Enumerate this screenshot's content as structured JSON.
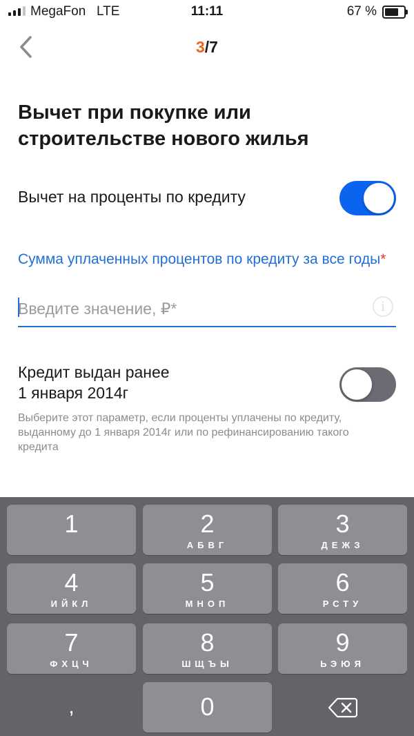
{
  "status_bar": {
    "carrier": "MegaFon",
    "network": "LTE",
    "time": "11:11",
    "battery": "67 %"
  },
  "header": {
    "step_current": "3",
    "step_total": "/7"
  },
  "title": "Вычет при покупке или строительстве нового жилья",
  "interest_toggle": {
    "label": "Вычет на проценты по кредиту",
    "on": true
  },
  "interest_field": {
    "label": "Сумма уплаченных процентов по кредиту за все годы",
    "required_mark": "*",
    "value": "",
    "placeholder": "Введите значение, ₽*",
    "info": "i"
  },
  "old_credit_toggle": {
    "label_line1": "Кредит выдан ранее",
    "label_line2": "1 января 2014г",
    "on": false,
    "hint": "Выберите этот параметр, если проценты уплачены по кредиту, выданному до 1 января 2014г или по рефинансированию такого кредита"
  },
  "keyboard": {
    "keys": [
      {
        "num": "1",
        "letters": ""
      },
      {
        "num": "2",
        "letters": "АБВГ"
      },
      {
        "num": "3",
        "letters": "ДЕЖЗ"
      },
      {
        "num": "4",
        "letters": "ИЙКЛ"
      },
      {
        "num": "5",
        "letters": "МНОП"
      },
      {
        "num": "6",
        "letters": "РСТУ"
      },
      {
        "num": "7",
        "letters": "ФХЦЧ"
      },
      {
        "num": "8",
        "letters": "ШЩЪЫ"
      },
      {
        "num": "9",
        "letters": "ЬЭЮЯ"
      }
    ],
    "comma": ",",
    "zero": "0"
  },
  "colors": {
    "accent": "#0a64ee",
    "step": "#f06414",
    "link": "#1f6fd4",
    "required": "#e53935",
    "keyboard_bg": "#646468",
    "key_bg": "#8e8e93"
  }
}
